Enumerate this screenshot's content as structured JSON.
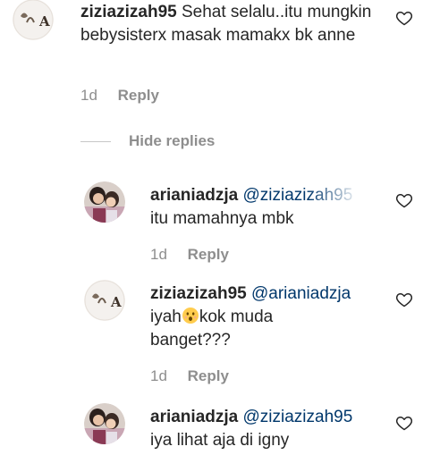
{
  "comments": [
    {
      "username": "ziziazizah95",
      "mention": "",
      "text": "Sehat selalu..itu mungkin bebysisterx masak mamakx bk anne",
      "time": "1d",
      "reply_label": "Reply",
      "avatar": "avatar-letter-a-icon"
    },
    {
      "username": "arianiadzja",
      "mention": "@ziziazizah95",
      "text": "itu mamahnya mbk",
      "time": "1d",
      "reply_label": "Reply",
      "avatar": "avatar-photo-icon"
    },
    {
      "username": "ziziazizah95",
      "mention": "@arianiadzja",
      "text_before_emoji": "iyah",
      "emoji": "astonished-face-icon",
      "text_after_emoji": "kok muda banget???",
      "time": "1d",
      "reply_label": "Reply",
      "avatar": "avatar-letter-a-icon"
    },
    {
      "username": "arianiadzja",
      "mention": "@ziziazizah95",
      "text": "iya lihat aja di igny",
      "avatar": "avatar-photo-icon"
    }
  ],
  "hide_replies_label": "Hide replies",
  "colors": {
    "text": "#262626",
    "mention": "#00376b",
    "meta": "#8e8e8e",
    "divider": "#c7c7c7"
  }
}
